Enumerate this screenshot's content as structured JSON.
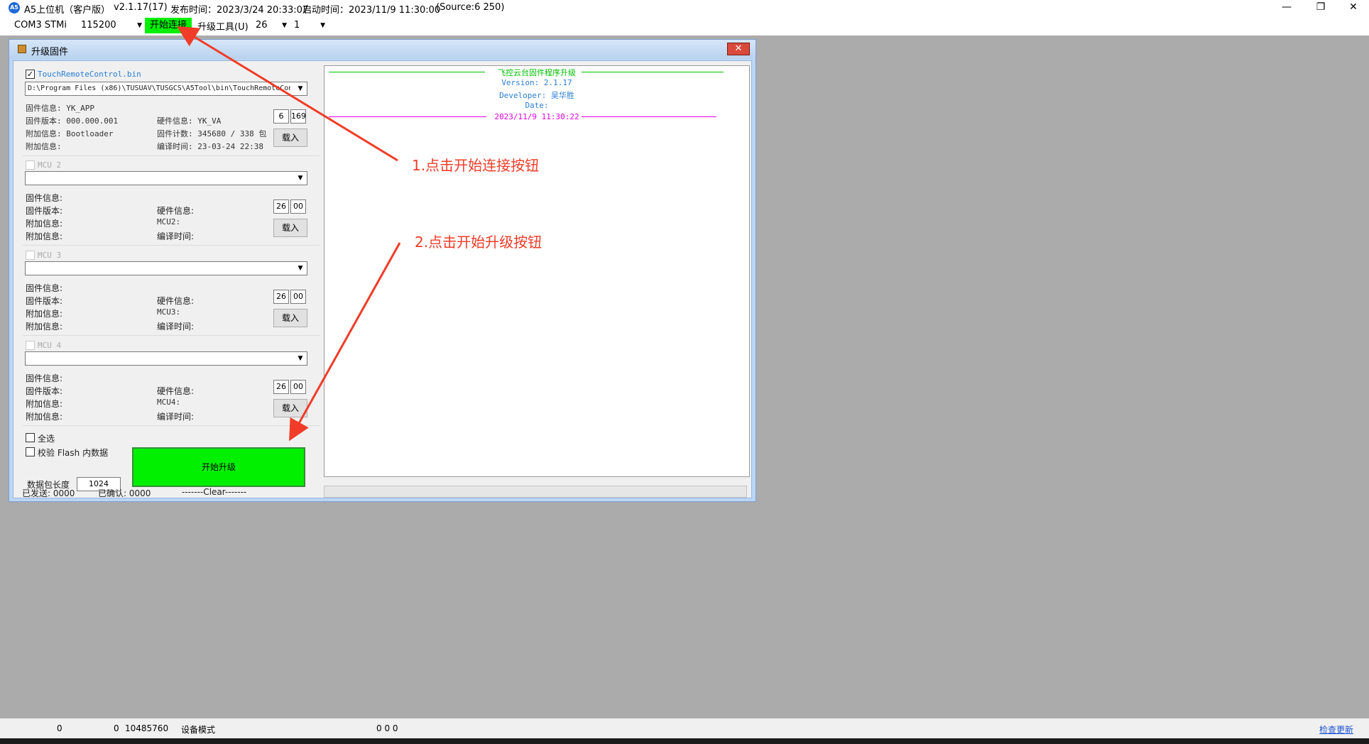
{
  "titlebar": {
    "logo": "A5",
    "app": "A5上位机（客户版）",
    "version": "v2.1.17(17)",
    "release": "发布时间：2023/3/24 20:33:07",
    "startup": "启动时间：2023/11/9 11:30:00",
    "source": "(Source:6 250)",
    "minimize": "—",
    "restore": "❐",
    "close": "✕"
  },
  "toolbar": {
    "port": "COM3 STMi",
    "baud": "115200",
    "connect_label": "开始连接",
    "tool_menu": "升级工具(U)",
    "sel_a": "26",
    "sel_b": "1"
  },
  "dialog": {
    "title": "升级固件",
    "close": "✕",
    "mcu1": {
      "checked": "✓",
      "file": "TouchRemoteControl.bin",
      "path": "D:\\Program Files (x86)\\TUSUAV\\TUSGCS\\A5Tool\\bin\\TouchRemoteCont",
      "fw_info": "固件信息: YK_APP",
      "fw_ver": "固件版本: 000.000.001",
      "extra1": "附加信息: Bootloader",
      "extra2": "附加信息:",
      "hw_info": "硬件信息: YK_VA",
      "fw_count": "固件计数: 345680 / 338 包",
      "build": "编译时间: 23-03-24 22:38",
      "num_a": "6",
      "num_b": "169",
      "load": "载入"
    },
    "mcu2": {
      "name": "MCU 2",
      "fw_info": "固件信息:",
      "fw_ver": "固件版本:",
      "extra1": "附加信息:",
      "extra2": "附加信息:",
      "hw_info": "硬件信息:",
      "mcu": "MCU2:",
      "build": "编译时间:",
      "num_a": "26",
      "num_b": "00",
      "load": "载入"
    },
    "mcu3": {
      "name": "MCU 3",
      "fw_info": "固件信息:",
      "fw_ver": "固件版本:",
      "extra1": "附加信息:",
      "extra2": "附加信息:",
      "hw_info": "硬件信息:",
      "mcu": "MCU3:",
      "build": "编译时间:",
      "num_a": "26",
      "num_b": "00",
      "load": "载入"
    },
    "mcu4": {
      "name": "MCU 4",
      "fw_info": "固件信息:",
      "fw_ver": "固件版本:",
      "extra1": "附加信息:",
      "extra2": "附加信息:",
      "hw_info": "硬件信息:",
      "mcu": "MCU4:",
      "build": "编译时间:",
      "num_a": "26",
      "num_b": "00",
      "load": "载入"
    },
    "select_all": "全选",
    "verify": "校验 Flash 内数据",
    "pkt_len_label": "数据包长度",
    "pkt_len": "1024",
    "upgrade_label": "开始升级",
    "log": {
      "title": "飞控云台固件程序升级",
      "version_label": "Version:",
      "version": "2.1.17",
      "developer_label": "Developer:",
      "developer": "吴华胜",
      "date_label": "Date:",
      "timestamp": "2023/11/9 11:30:22"
    },
    "status": {
      "sent": "已发送: 0000",
      "ack": "已确认: 0000",
      "clear": "-------Clear-------"
    },
    "colors": {
      "title_line": "#00c000",
      "ts_line": "#e000e0",
      "version": "#2a7fd4",
      "upgrade_bg": "#00f000"
    }
  },
  "annotations": {
    "step1": "1.点击开始连接按钮",
    "step2": "2.点击开始升级按钮",
    "color": "#f03c28"
  },
  "bottombar": {
    "a": "0",
    "b": "0",
    "c": "10485760",
    "mode": "设备模式",
    "d": "0  0  0",
    "update": "检查更新"
  }
}
